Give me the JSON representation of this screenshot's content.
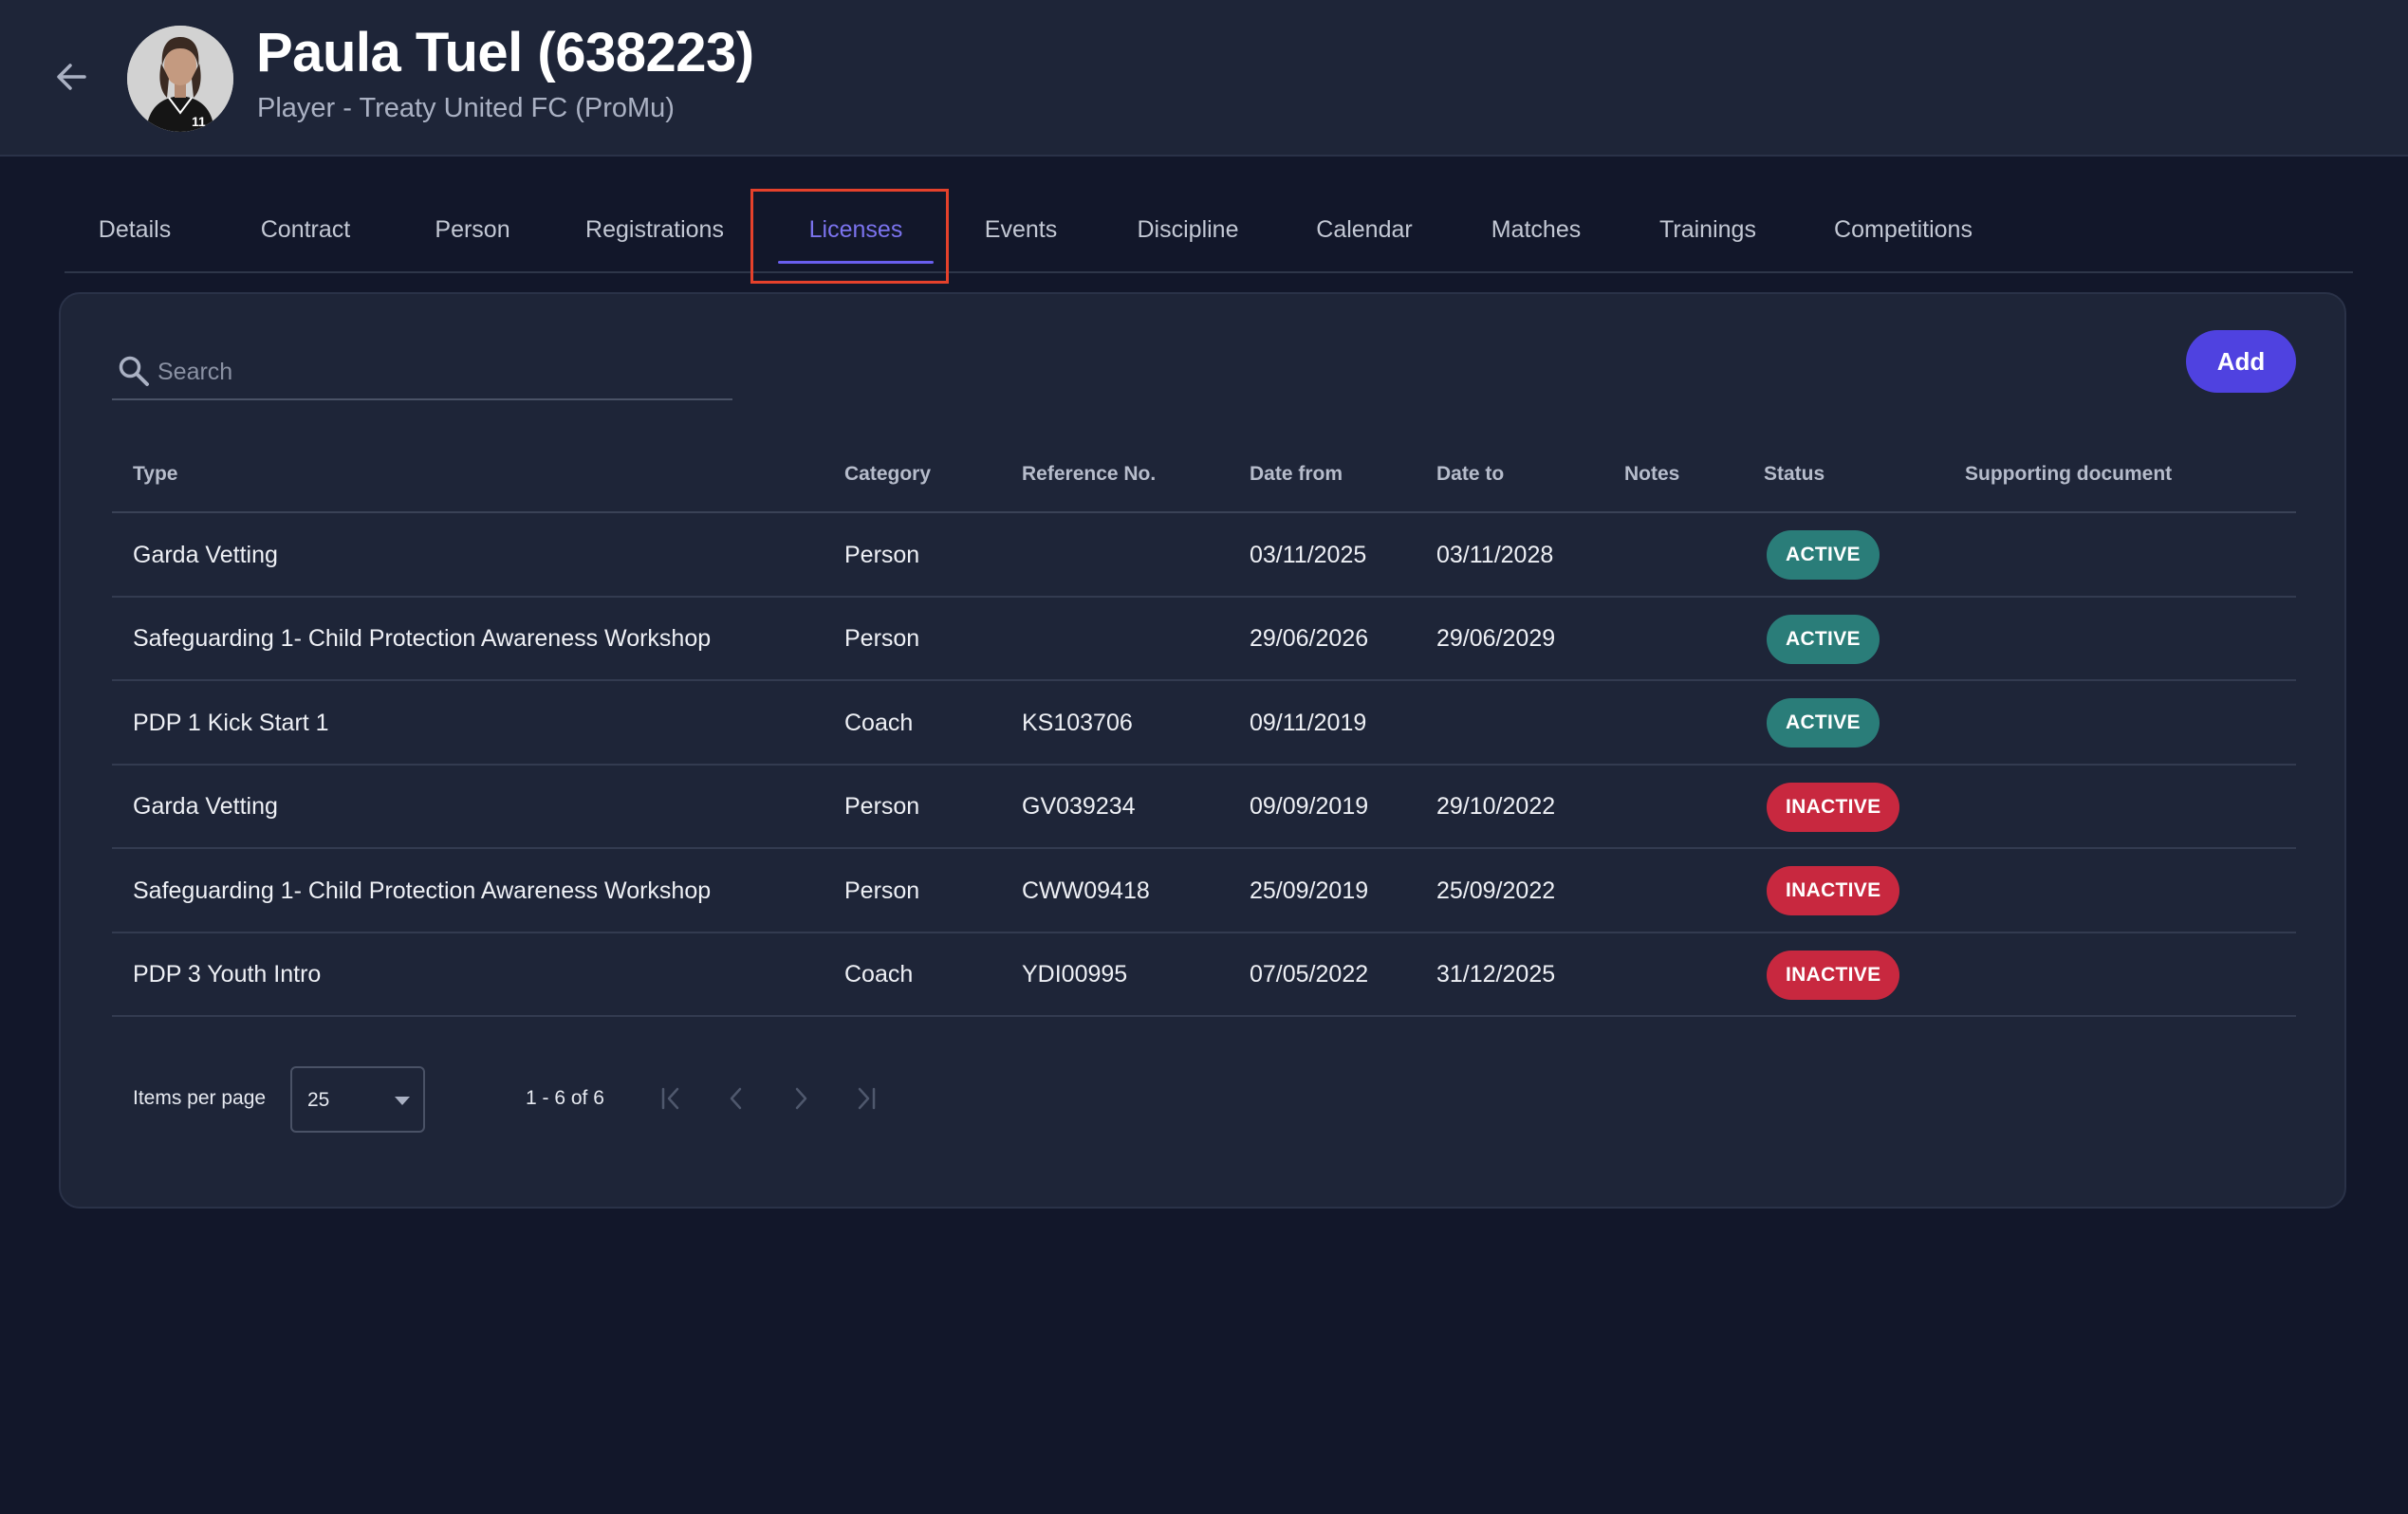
{
  "header": {
    "title": "Paula Tuel (638223)",
    "subtitle": "Player - Treaty United FC (ProMu)"
  },
  "tabs": [
    {
      "label": "Details",
      "active": false
    },
    {
      "label": "Contract",
      "active": false
    },
    {
      "label": "Person",
      "active": false
    },
    {
      "label": "Registrations",
      "active": false
    },
    {
      "label": "Licenses",
      "active": true
    },
    {
      "label": "Events",
      "active": false
    },
    {
      "label": "Discipline",
      "active": false
    },
    {
      "label": "Calendar",
      "active": false
    },
    {
      "label": "Matches",
      "active": false
    },
    {
      "label": "Trainings",
      "active": false
    },
    {
      "label": "Competitions",
      "active": false
    }
  ],
  "search": {
    "placeholder": "Search",
    "value": ""
  },
  "toolbar": {
    "add_label": "Add"
  },
  "table": {
    "columns": [
      "Type",
      "Category",
      "Reference No.",
      "Date from",
      "Date to",
      "Notes",
      "Status",
      "Supporting document"
    ],
    "rows": [
      {
        "type": "Garda Vetting",
        "category": "Person",
        "reference": "",
        "date_from": "03/11/2025",
        "date_to": "03/11/2028",
        "notes": "",
        "status": "ACTIVE",
        "supporting_document": ""
      },
      {
        "type": "Safeguarding 1- Child Protection Awareness Workshop",
        "category": "Person",
        "reference": "",
        "date_from": "29/06/2026",
        "date_to": "29/06/2029",
        "notes": "",
        "status": "ACTIVE",
        "supporting_document": ""
      },
      {
        "type": "PDP 1 Kick Start 1",
        "category": "Coach",
        "reference": "KS103706",
        "date_from": "09/11/2019",
        "date_to": "",
        "notes": "",
        "status": "ACTIVE",
        "supporting_document": ""
      },
      {
        "type": "Garda Vetting",
        "category": "Person",
        "reference": "GV039234",
        "date_from": "09/09/2019",
        "date_to": "29/10/2022",
        "notes": "",
        "status": "INACTIVE",
        "supporting_document": ""
      },
      {
        "type": "Safeguarding 1- Child Protection Awareness Workshop",
        "category": "Person",
        "reference": "CWW09418",
        "date_from": "25/09/2019",
        "date_to": "25/09/2022",
        "notes": "",
        "status": "INACTIVE",
        "supporting_document": ""
      },
      {
        "type": "PDP 3 Youth Intro",
        "category": "Coach",
        "reference": "YDI00995",
        "date_from": "07/05/2022",
        "date_to": "31/12/2025",
        "notes": "",
        "status": "INACTIVE",
        "supporting_document": ""
      }
    ]
  },
  "pagination": {
    "items_per_page_label": "Items per page",
    "items_per_page": "25",
    "range": "1 - 6 of 6"
  },
  "colors": {
    "accent": "#4f42e0",
    "active_tab": "#7b73ee",
    "status_active": "#2a7d79",
    "status_inactive": "#c8283f",
    "highlight_box": "#e5412b"
  },
  "icons": [
    "arrow-left-icon",
    "search-icon",
    "chevron-down-icon",
    "first-page-icon",
    "prev-page-icon",
    "next-page-icon",
    "last-page-icon"
  ]
}
